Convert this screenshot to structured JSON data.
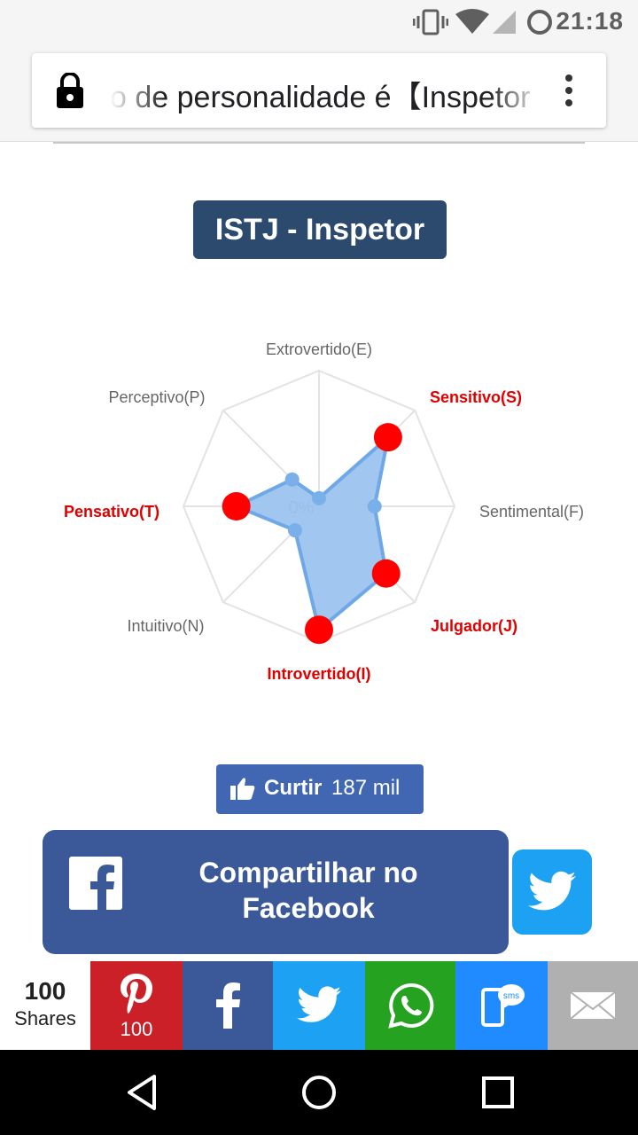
{
  "status_bar": {
    "time": "21:18",
    "icons": [
      "vibrate-icon",
      "wifi-icon",
      "cell-signal-icon",
      "battery-charging-icon"
    ]
  },
  "browser": {
    "url_text": "o de personalidade é【Inspetor",
    "lock_icon": "lock-icon",
    "menu_icon": "more-vert-icon"
  },
  "result": {
    "title": "ISTJ - Inspetor"
  },
  "chart_data": {
    "type": "radar",
    "center_label": "0%",
    "axes": [
      {
        "label": "Extrovertido(E)",
        "highlight": false
      },
      {
        "label": "Sensitivo(S)",
        "highlight": true
      },
      {
        "label": "Sentimental(F)",
        "highlight": false
      },
      {
        "label": "Julgador(J)",
        "highlight": true
      },
      {
        "label": "Introvertido(I)",
        "highlight": true
      },
      {
        "label": "Intuitivo(N)",
        "highlight": false
      },
      {
        "label": "Pensativo(T)",
        "highlight": true
      },
      {
        "label": "Perceptivo(P)",
        "highlight": false
      }
    ],
    "values": [
      6,
      72,
      41,
      70,
      91,
      25,
      61,
      28
    ],
    "max": 100,
    "colors": {
      "fill": "#9cc3ee",
      "stroke": "#6ea8e6",
      "point": "#7ab0ea",
      "highlight_point": "#ff0000",
      "highlight_label": "#e00000",
      "label": "#666666",
      "grid": "#e3e3e3"
    }
  },
  "like": {
    "label": "Curtir",
    "count": "187 mil"
  },
  "share_facebook": {
    "label": "Compartilhar no Facebook"
  },
  "share_bar": {
    "count": "100",
    "count_label": "Shares",
    "pinterest_count": "100",
    "buttons": [
      {
        "name": "pinterest",
        "color": "#cb2027"
      },
      {
        "name": "facebook",
        "color": "#3b5998"
      },
      {
        "name": "twitter",
        "color": "#1da1f2"
      },
      {
        "name": "whatsapp",
        "color": "#25a320"
      },
      {
        "name": "sms",
        "color": "#1f8bff"
      },
      {
        "name": "email",
        "color": "#b0b0b0"
      }
    ]
  },
  "nav": {
    "buttons": [
      "back-icon",
      "home-icon",
      "recents-icon"
    ]
  }
}
